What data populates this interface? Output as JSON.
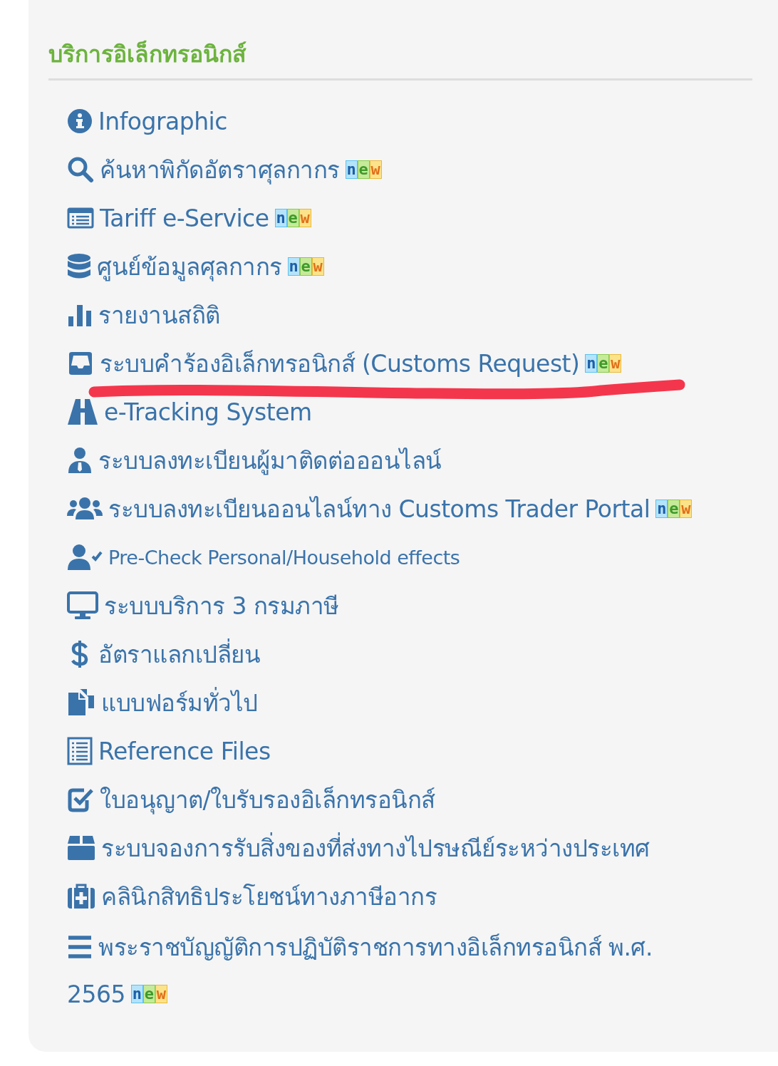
{
  "section": {
    "title": "บริการอิเล็กทรอนิกส์",
    "items": [
      {
        "label": "Infographic",
        "kind": "standard"
      },
      {
        "label": "ค้นหาพิกัดอัตราศุลกากร",
        "kind": "standard",
        "badge": "new"
      },
      {
        "label": "Tariff e-Service",
        "kind": "standard",
        "badge": "new"
      },
      {
        "label": "ศูนย์ข้อมูลศุลกากร",
        "kind": "standard",
        "badge": "new"
      },
      {
        "label": "รายงานสถิติ",
        "kind": "standard"
      },
      {
        "label": "ระบบคำร้องอิเล็กทรอนิกส์ (Customs Request)",
        "kind": "standard",
        "badge": "new"
      },
      {
        "label": "e-Tracking System",
        "kind": "standard"
      },
      {
        "label": "ระบบลงทะเบียนผู้มาติดต่อออนไลน์",
        "kind": "standard"
      },
      {
        "label": "ระบบลงทะเบียนออนไลน์ทาง Customs Trader Portal",
        "kind": "standard",
        "badge": "new"
      },
      {
        "label": "Pre-Check Personal/Household effects",
        "kind": "compact"
      },
      {
        "label": "ระบบบริการ 3 กรมภาษี",
        "kind": "standard"
      },
      {
        "label": "อัตราแลกเปลี่ยน",
        "kind": "standard"
      },
      {
        "label": "แบบฟอร์มทั่วไป",
        "kind": "standard"
      },
      {
        "label": "Reference Files",
        "kind": "standard"
      },
      {
        "label": "ใบอนุญาต/ใบรับรองอิเล็กทรอนิกส์",
        "kind": "standard"
      },
      {
        "label": "ระบบจองการรับสิ่งของที่ส่งทางไปรษณีย์ระหว่างประเทศ",
        "kind": "standard"
      },
      {
        "label": "คลินิกสิทธิประโยชน์ทางภาษีอากร",
        "kind": "standard"
      },
      {
        "label": "พระราชบัญญัติการปฏิบัติราชการทางอิเล็กทรอนิกส์ พ.ศ. 2565",
        "kind": "standard",
        "badge": "new"
      }
    ]
  }
}
